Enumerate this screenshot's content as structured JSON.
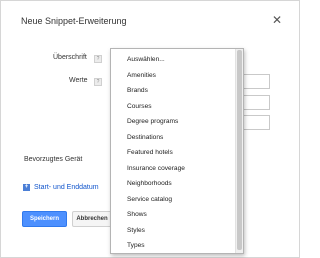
{
  "dialog": {
    "title": "Neue Snippet-Erweiterung",
    "close_icon": "close-icon"
  },
  "form": {
    "heading_label": "Überschrift",
    "values_label": "Werte",
    "device_label": "Bevorzugtes Gerät",
    "help_glyph": "?",
    "dates_link": "Start- und Enddatum"
  },
  "dropdown": {
    "options": [
      "Auswählen...",
      "Amenities",
      "Brands",
      "Courses",
      "Degree programs",
      "Destinations",
      "Featured hotels",
      "Insurance coverage",
      "Neighborhoods",
      "Service catalog",
      "Shows",
      "Styles",
      "Types"
    ]
  },
  "buttons": {
    "save": "Speichern",
    "cancel": "Abbrechen"
  },
  "colors": {
    "primary": "#4d90fe",
    "link": "#1155cc"
  }
}
